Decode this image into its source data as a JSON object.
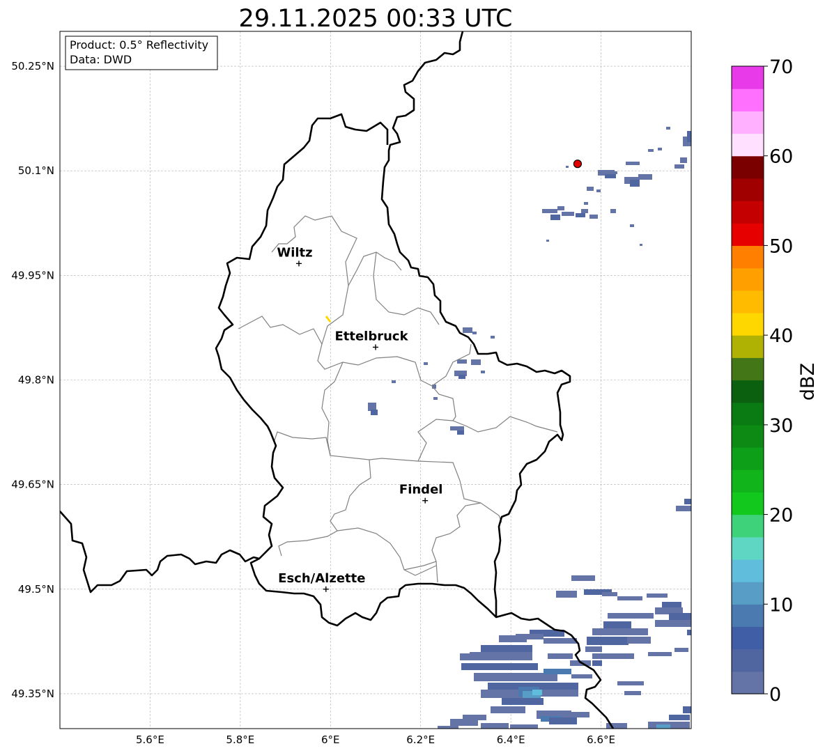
{
  "title": "29.11.2025 00:33 UTC",
  "info_box": {
    "product": "Product: 0.5° Reflectivity",
    "data": "Data: DWD"
  },
  "map": {
    "lon_range": [
      5.4,
      6.8
    ],
    "lat_range": [
      49.3,
      50.3
    ],
    "x_ticks": [
      {
        "lon": 5.6,
        "label": "5.6°E"
      },
      {
        "lon": 5.8,
        "label": "5.8°E"
      },
      {
        "lon": 6.0,
        "label": "6°E"
      },
      {
        "lon": 6.2,
        "label": "6.2°E"
      },
      {
        "lon": 6.4,
        "label": "6.4°E"
      },
      {
        "lon": 6.6,
        "label": "6.6°E"
      }
    ],
    "y_ticks": [
      {
        "lat": 50.25,
        "label": "50.25°N"
      },
      {
        "lat": 50.1,
        "label": "50.1°N"
      },
      {
        "lat": 49.95,
        "label": "49.95°N"
      },
      {
        "lat": 49.8,
        "label": "49.8°N"
      },
      {
        "lat": 49.65,
        "label": "49.65°N"
      },
      {
        "lat": 49.5,
        "label": "49.5°N"
      },
      {
        "lat": 49.35,
        "label": "49.35°N"
      }
    ],
    "gridlines": true,
    "cities": [
      {
        "name": "Wiltz",
        "lon": 5.93,
        "lat": 49.967
      },
      {
        "name": "Ettelbruck",
        "lon": 6.1,
        "lat": 49.847
      },
      {
        "name": "Findel",
        "lon": 6.21,
        "lat": 49.627
      },
      {
        "name": "Esch/Alzette",
        "lon": 5.99,
        "lat": 49.5
      }
    ],
    "radar_site": {
      "lon": 6.548,
      "lat": 50.11,
      "color": "#e00000"
    }
  },
  "colorbar": {
    "label": "dBZ",
    "min": 0,
    "max": 70,
    "ticks": [
      0,
      10,
      20,
      30,
      40,
      50,
      60,
      70
    ],
    "colors": [
      "#6474a6",
      "#4f66a0",
      "#405ea6",
      "#4a7ab0",
      "#589dc6",
      "#60bedc",
      "#5fd6c4",
      "#3ed37a",
      "#12c81c",
      "#11b51b",
      "#0e9f18",
      "#0c8a14",
      "#0a7a12",
      "#0b6010",
      "#437616",
      "#afb203",
      "#ffd700",
      "#ffbb00",
      "#ffa000",
      "#ff8000",
      "#e60000",
      "#c40000",
      "#a00000",
      "#7a0000",
      "#ffe0ff",
      "#ffb0ff",
      "#ff70ff",
      "#e83ae8"
    ]
  }
}
